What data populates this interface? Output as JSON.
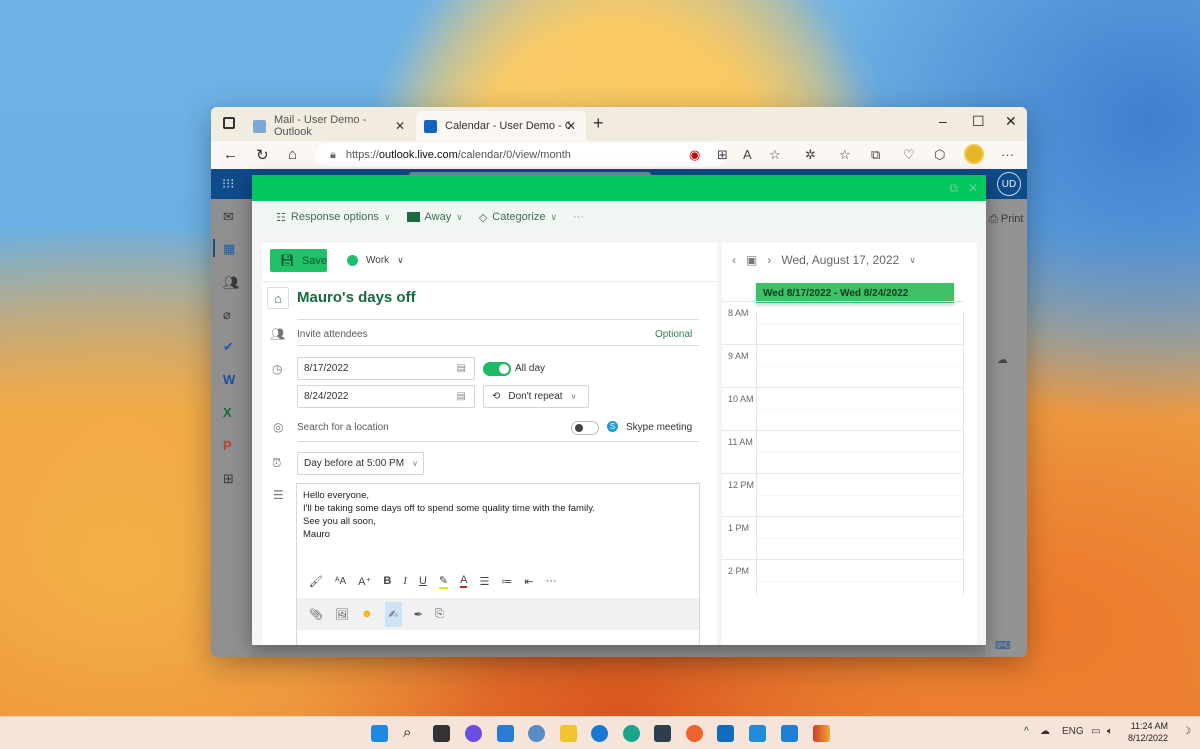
{
  "browser": {
    "tabs": [
      {
        "title": "Mail - User Demo - Outlook",
        "active": false
      },
      {
        "title": "Calendar - User Demo - Outlool",
        "active": true
      }
    ],
    "url_prefix": "https://",
    "url_domain": "outlook.live.com",
    "url_path": "/calendar/0/view/month",
    "new_tab": "+",
    "window_controls": {
      "minimize": "–",
      "maximize": "☐",
      "close": "✕"
    },
    "more": "···"
  },
  "app": {
    "user_initials": "UD",
    "print_label": "Print",
    "sidebar_icons": [
      "mail-icon",
      "calendar-icon",
      "people-icon",
      "attach-icon",
      "todo-icon",
      "word-icon",
      "excel-icon",
      "powerpoint-icon",
      "apps-icon"
    ]
  },
  "commandbar": {
    "response_options": "Response options",
    "away": "Away",
    "categorize": "Categorize",
    "more": "···"
  },
  "form": {
    "save_label": "Save",
    "calendar_name": "Work",
    "calendar_color": "#1ec06b",
    "title": "Mauro's days off",
    "invite_placeholder": "Invite attendees",
    "optional_label": "Optional",
    "start_date": "8/17/2022",
    "end_date": "8/24/2022",
    "all_day_label": "All day",
    "all_day": true,
    "repeat_label": "Don't repeat",
    "location_placeholder": "Search for a location",
    "skype_label": "Skype meeting",
    "skype_enabled": false,
    "reminder": "Day before at 5:00 PM",
    "body_lines": [
      "Hello everyone,",
      "I'll be taking some days off to spend some quality time with the family.",
      "See you all soon,",
      "Mauro"
    ]
  },
  "side_calendar": {
    "date_label": "Wed, August 17, 2022",
    "event_range": "Wed 8/17/2022 - Wed 8/24/2022",
    "hours": [
      "8 AM",
      "9 AM",
      "10 AM",
      "11 AM",
      "12 PM",
      "1 PM",
      "2 PM"
    ]
  },
  "taskbar": {
    "language": "ENG",
    "time": "11:24 AM",
    "date": "8/12/2022"
  },
  "colors": {
    "accent_green": "#04c85e",
    "outlook_blue": "#0f4a8a"
  }
}
